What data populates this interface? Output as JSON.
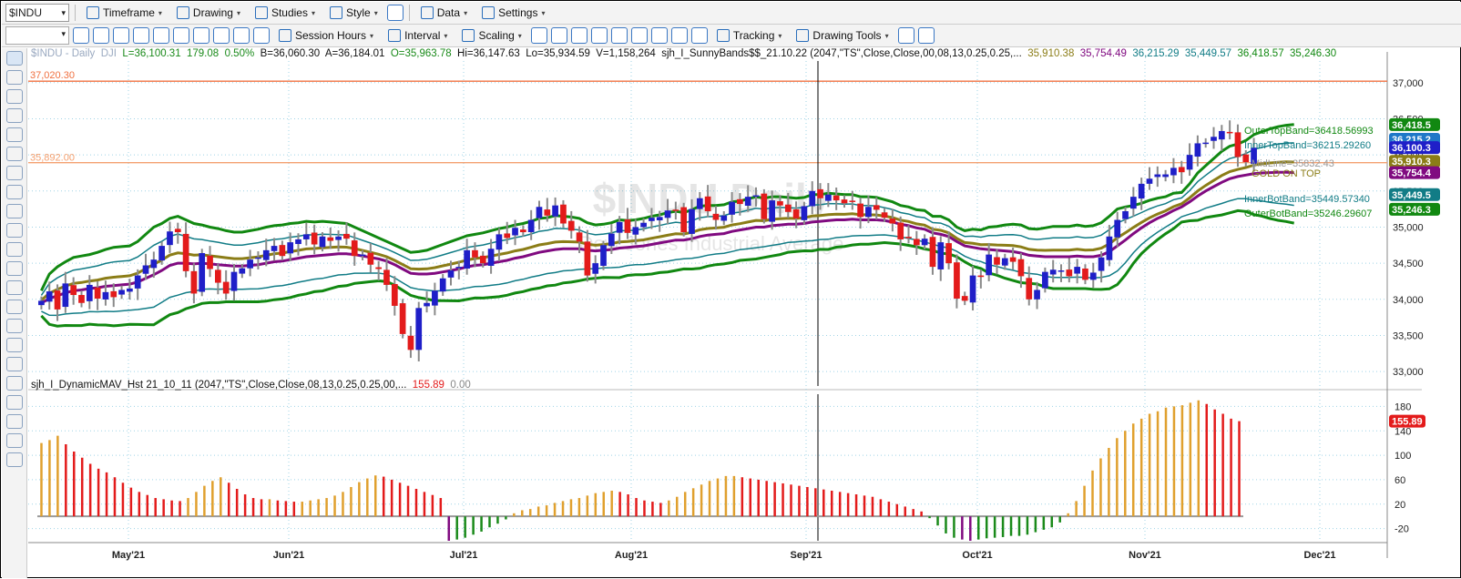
{
  "toolbar1": {
    "symbol": "$INDU",
    "items": [
      "Timeframe",
      "Drawing",
      "Studies",
      "Style",
      "Data",
      "Settings"
    ]
  },
  "toolbar2": {
    "items": [
      "Session Hours",
      "Interval",
      "Scaling",
      "Tracking",
      "Drawing Tools"
    ]
  },
  "header": {
    "symbol": "$INDU - Daily",
    "exchange": "DJI",
    "last": "L=36,100.31",
    "change": "179.08",
    "pct": "0.50%",
    "bid": "B=36,060.30",
    "ask": "A=36,184.01",
    "open": "O=35,963.78",
    "high": "Hi=36,147.63",
    "low": "Lo=35,934.59",
    "volume": "V=1,158,264",
    "study": "sjh_I_SunnyBands$$_21.10.22 (2047,\"TS\",Close,Close,00,08,13,0.25,0.25,...",
    "v1": "35,910.38",
    "v2": "35,754.49",
    "v3": "36,215.29",
    "v4": "35,449.57",
    "v5": "36,418.57",
    "v6": "35,246.30"
  },
  "indicator2": {
    "label": "sjh_I_DynamicMAV_Hst 21_10_11 (2047,\"TS\",Close,Close,08,13,0.25,0.25,00,...",
    "value": "155.89",
    "zero": "0.00"
  },
  "annotations": {
    "line_top": "37,020.30",
    "line_mid": "35,892.00",
    "outer_top": "OuterTopBand=36418.56993",
    "inner_top": "InnerTopBand=36215.29260",
    "midline": "MidLine=35832.43",
    "gold": "GOLD ON TOP",
    "inner_bot": "InnerBotBand=35449.57340",
    "outer_bot": "OuterBotBand=35246.29607",
    "watermark1": "$INDU Daily",
    "watermark2": "Dow Jones Industrial Average"
  },
  "price_tags": [
    "36,418.5",
    "36,215.2",
    "36,100.3",
    "35,910.3",
    "35,754.4",
    "35,449.5",
    "35,246.3"
  ],
  "osc_tag": "155.89",
  "colors": {
    "up": "#1f1fc8",
    "down": "#e31b1b",
    "outer": "#118811",
    "inner": "#117c86",
    "mid": "#800a80",
    "gold": "#8b7d17",
    "hist_up": "#e0a02e",
    "hist_down": "#e31b1b",
    "hist_neg": "#1a8a1a",
    "hist_neg2": "#800a80",
    "hline_top": "#f07040",
    "hline_mid": "#f4a070"
  },
  "chart_data": [
    {
      "type": "candlestick",
      "title": "$INDU - Daily",
      "ylim": [
        32800,
        37300
      ],
      "yticks": [
        33000,
        33500,
        34000,
        34500,
        35000,
        35500,
        36000,
        36500,
        37000
      ],
      "ytick_labels": [
        "33,000",
        "33,500",
        "34,000",
        "34,500",
        "35,000",
        "35,500",
        "36,000",
        "36,500",
        "37,000"
      ],
      "x_labels": [
        "May'21",
        "Jun'21",
        "Jul'21",
        "Aug'21",
        "Sep'21",
        "Oct'21",
        "Nov'21",
        "Dec'21"
      ],
      "close": [
        33980,
        34110,
        33860,
        34220,
        34060,
        33950,
        34200,
        34010,
        34100,
        34030,
        34130,
        34150,
        34330,
        34470,
        34550,
        34740,
        34940,
        34930,
        34390,
        34080,
        34640,
        34420,
        34230,
        34080,
        34380,
        34430,
        34550,
        34580,
        34680,
        34740,
        34600,
        34790,
        34830,
        34900,
        34760,
        34870,
        34810,
        34870,
        34840,
        34600,
        34620,
        34480,
        34420,
        34200,
        33910,
        33520,
        33300,
        33880,
        33950,
        34120,
        34290,
        34400,
        34450,
        34680,
        34580,
        34500,
        34700,
        34900,
        34850,
        34990,
        34930,
        35100,
        35280,
        35160,
        35300,
        35050,
        34950,
        34800,
        34330,
        34500,
        34750,
        34910,
        35070,
        34920,
        35000,
        35060,
        35130,
        35140,
        35230,
        35240,
        34930,
        35250,
        35400,
        35220,
        35100,
        35160,
        35350,
        35320,
        35420,
        35440,
        35110,
        35370,
        35300,
        35210,
        35120,
        35290,
        35500,
        35400,
        35450,
        35370,
        35330,
        35350,
        35140,
        35280,
        35240,
        35130,
        35050,
        34830,
        34860,
        34750,
        34840,
        34450,
        34790,
        34500,
        34010,
        33980,
        34330,
        34310,
        34620,
        34480,
        34570,
        34520,
        34320,
        34000,
        34130,
        34380,
        34410,
        34400,
        34320,
        34450,
        34270,
        34370,
        34580,
        34870,
        35100,
        35220,
        35420,
        35600,
        35670,
        35730,
        35730,
        35820,
        35760,
        36000,
        36160,
        36170,
        36250,
        36330,
        36300,
        35970,
        35900,
        36100
      ],
      "upper_outer": [
        34120,
        34350,
        34450,
        34520,
        34580,
        34600,
        34620,
        34650,
        34690,
        34720,
        34730,
        34740,
        34800,
        34900,
        35000,
        35050,
        35120,
        35150,
        35100,
        35050,
        35030,
        35000,
        34980,
        34950,
        34930,
        34930,
        34950,
        34970,
        35000,
        35020,
        35030,
        35050,
        35060,
        35080,
        35070,
        35080,
        35070,
        35060,
        35050,
        35000,
        34950,
        34900,
        34850,
        34800,
        34750,
        34700,
        34650,
        34660,
        34680,
        34720,
        34760,
        34800,
        34840,
        34880,
        34900,
        34920,
        34950,
        34980,
        35000,
        35030,
        35050,
        35080,
        35120,
        35130,
        35160,
        35150,
        35140,
        35120,
        35060,
        35030,
        35040,
        35060,
        35100,
        35090,
        35100,
        35120,
        35150,
        35170,
        35200,
        35220,
        35200,
        35240,
        35290,
        35300,
        35300,
        35310,
        35350,
        35360,
        35390,
        35420,
        35400,
        35420,
        35420,
        35410,
        35400,
        35410,
        35450,
        35450,
        35470,
        35460,
        35450,
        35450,
        35420,
        35420,
        35410,
        35380,
        35350,
        35300,
        35280,
        35240,
        35230,
        35150,
        35150,
        35100,
        35000,
        34950,
        34970,
        34960,
        35000,
        35010,
        35030,
        35040,
        35030,
        34980,
        34970,
        34990,
        35010,
        35010,
        35010,
        35030,
        35010,
        35020,
        35060,
        35150,
        35250,
        35280,
        35300,
        35330,
        35370,
        35400,
        35420,
        35470,
        35480,
        35600,
        35750,
        35850,
        35950,
        36050,
        36120,
        36150,
        36200,
        36280,
        36320,
        36360,
        36390,
        36410,
        36420
      ],
      "mid": [
        33950,
        34010,
        34050,
        34090,
        34120,
        34130,
        34150,
        34160,
        34180,
        34190,
        34200,
        34210,
        34240,
        34290,
        34340,
        34400,
        34470,
        34500,
        34500,
        34490,
        34500,
        34490,
        34480,
        34470,
        34460,
        34460,
        34470,
        34480,
        34500,
        34520,
        34530,
        34550,
        34570,
        34590,
        34600,
        34610,
        34620,
        34630,
        34630,
        34620,
        34600,
        34580,
        34560,
        34530,
        34480,
        34420,
        34360,
        34350,
        34350,
        34360,
        34380,
        34400,
        34420,
        34450,
        34470,
        34480,
        34500,
        34520,
        34540,
        34570,
        34590,
        34620,
        34650,
        34670,
        34690,
        34700,
        34700,
        34700,
        34680,
        34670,
        34680,
        34690,
        34710,
        34720,
        34730,
        34740,
        34760,
        34780,
        34800,
        34820,
        34820,
        34840,
        34870,
        34890,
        34900,
        34910,
        34940,
        34960,
        34980,
        35000,
        35000,
        35020,
        35030,
        35040,
        35040,
        35050,
        35070,
        35080,
        35090,
        35100,
        35100,
        35110,
        35100,
        35100,
        35100,
        35090,
        35070,
        35040,
        35020,
        34990,
        34970,
        34920,
        34900,
        34870,
        34800,
        34740,
        34720,
        34700,
        34690,
        34680,
        34670,
        34660,
        34640,
        34610,
        34600,
        34590,
        34590,
        34590,
        34590,
        34600,
        34590,
        34590,
        34610,
        34660,
        34740,
        34820,
        34910,
        34990,
        35060,
        35120,
        35170,
        35230,
        35280,
        35350,
        35430,
        35500,
        35560,
        35620,
        35670,
        35700,
        35720,
        35740,
        35750,
        35755,
        35758,
        35760,
        35754
      ]
    },
    {
      "type": "bar",
      "title": "sjh_I_DynamicMAV_Hst 21_10_11",
      "ylim": [
        -40,
        200
      ],
      "yticks": [
        -20,
        20,
        60,
        100,
        140,
        180
      ],
      "values": [
        120,
        125,
        132,
        118,
        106,
        96,
        86,
        78,
        72,
        64,
        55,
        47,
        40,
        35,
        30,
        28,
        26,
        25,
        30,
        40,
        50,
        58,
        64,
        55,
        45,
        36,
        30,
        28,
        28,
        26,
        25,
        24,
        24,
        26,
        28,
        30,
        34,
        40,
        48,
        56,
        62,
        67,
        65,
        60,
        55,
        50,
        45,
        40,
        35,
        30,
        -40,
        -38,
        -35,
        -30,
        -25,
        -18,
        -12,
        -5,
        5,
        10,
        12,
        16,
        18,
        22,
        25,
        28,
        30,
        34,
        38,
        40,
        42,
        40,
        36,
        30,
        26,
        24,
        22,
        26,
        32,
        40,
        46,
        52,
        58,
        62,
        66,
        66,
        64,
        62,
        60,
        58,
        56,
        54,
        52,
        50,
        48,
        46,
        44,
        42,
        40,
        38,
        36,
        34,
        32,
        28,
        24,
        20,
        16,
        12,
        8,
        -3,
        -15,
        -28,
        -35,
        -38,
        -40,
        -38,
        -36,
        -35,
        -34,
        -32,
        -32,
        -30,
        -26,
        -22,
        -18,
        -10,
        5,
        25,
        50,
        75,
        95,
        112,
        128,
        140,
        152,
        160,
        168,
        172,
        178,
        180,
        182,
        186,
        190,
        184,
        175,
        168,
        160,
        155.89
      ]
    }
  ]
}
